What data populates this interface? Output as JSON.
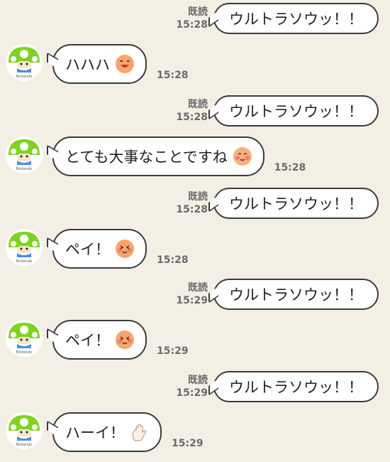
{
  "messages": [
    {
      "type": "sent",
      "read": "既読",
      "time": "15:28",
      "text": "ウルトラソウッ！！"
    },
    {
      "type": "received",
      "text": "ハハハ",
      "time": "15:28",
      "emoji": "grinning-face-icon",
      "avatar_label": "Nintendo"
    },
    {
      "type": "sent",
      "read": "既読",
      "time": "15:28",
      "text": "ウルトラソウッ！！"
    },
    {
      "type": "received",
      "text": "とても大事なことですね",
      "time": "15:28",
      "emoji": "blushing-face-icon",
      "avatar_label": "Nintendo"
    },
    {
      "type": "sent",
      "read": "既読",
      "time": "15:28",
      "text": "ウルトラソウッ！！"
    },
    {
      "type": "received",
      "text": "ペイ！",
      "time": "15:28",
      "emoji": "smiling-face-icon",
      "avatar_label": "Nintendo"
    },
    {
      "type": "sent",
      "read": "既読",
      "time": "15:29",
      "text": "ウルトラソウッ！！"
    },
    {
      "type": "received",
      "text": "ペイ！",
      "time": "15:29",
      "emoji": "smiling-face-icon",
      "avatar_label": "Nintendo"
    },
    {
      "type": "sent",
      "read": "既読",
      "time": "15:29",
      "text": "ウルトラソウッ！！"
    },
    {
      "type": "received",
      "text": "ハーイ！",
      "time": "15:29",
      "emoji": "waving-hand-icon",
      "avatar_label": "Nintendo"
    }
  ],
  "colors": {
    "background": "#f3efe5",
    "bubble": "#ffffff",
    "border": "#3b3b3b",
    "avatar_green": "#7ed321"
  }
}
